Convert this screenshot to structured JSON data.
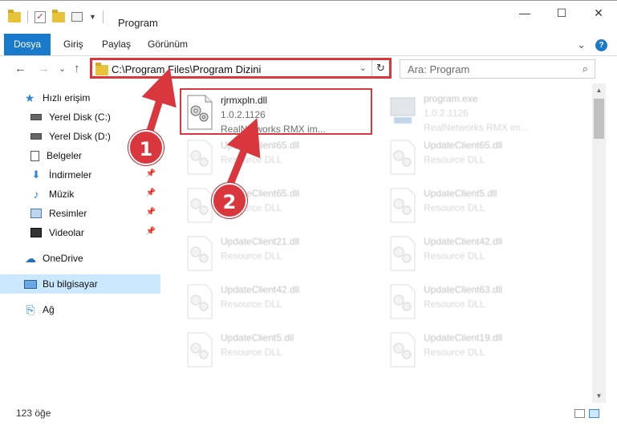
{
  "window": {
    "title": "Program",
    "minimize": "—",
    "maximize": "☐",
    "close": "✕"
  },
  "ribbon": {
    "tabs": [
      {
        "label": "Dosya"
      },
      {
        "label": "Giriş"
      },
      {
        "label": "Paylaş"
      },
      {
        "label": "Görünüm"
      }
    ],
    "expand_glyph": "⌄",
    "help_glyph": "?"
  },
  "nav": {
    "back": "←",
    "forward": "→",
    "recent": "⌄",
    "up": "↑",
    "address": "C:\\Program Files\\Program Dizini",
    "address_dropdown": "⌄",
    "refresh": "↻",
    "search_placeholder": "Ara: Program",
    "search_glyph": "⌕"
  },
  "sidebar": {
    "items": [
      {
        "label": "Hızlı erişim"
      },
      {
        "label": "Yerel Disk (C:)"
      },
      {
        "label": "Yerel Disk (D:)"
      },
      {
        "label": "Belgeler"
      },
      {
        "label": "İndirmeler"
      },
      {
        "label": "Müzik"
      },
      {
        "label": "Resimler"
      },
      {
        "label": "Videolar"
      },
      {
        "label": "OneDrive"
      },
      {
        "label": "Bu bilgisayar"
      },
      {
        "label": "Ağ"
      }
    ],
    "pin_glyph": "📌"
  },
  "files": [
    {
      "name": "rjrmxpln.dll",
      "line2": "1.0.2.1126",
      "line3": "RealNetworks RMX im..."
    },
    {
      "name": "program.exe",
      "line2": "1.0.2.1126",
      "line3": "RealNetworks RMX im..."
    },
    {
      "name": "UpdateClient65.dll",
      "line2": "Resource DLL"
    },
    {
      "name": "UpdateClient65.dll",
      "line2": "Resource DLL"
    },
    {
      "name": "UpdateClient65.dll",
      "line2": "Resource DLL"
    },
    {
      "name": "UpdateClient5.dll",
      "line2": "Resource DLL"
    },
    {
      "name": "UpdateClient21.dll",
      "line2": "Resource DLL"
    },
    {
      "name": "UpdateClient42.dll",
      "line2": "Resource DLL"
    },
    {
      "name": "UpdateClient42.dll",
      "line2": "Resource DLL"
    },
    {
      "name": "UpdateClient63.dll",
      "line2": "Resource DLL"
    },
    {
      "name": "UpdateClient5.dll",
      "line2": "Resource DLL"
    },
    {
      "name": "UpdateClient19.dll",
      "line2": "Resource DLL"
    }
  ],
  "status": {
    "count": "123 öğe"
  },
  "callouts": {
    "one": "1",
    "two": "2"
  },
  "colors": {
    "accent": "#1979ca",
    "highlight_red": "#d9363e",
    "selection": "#cce8ff"
  }
}
